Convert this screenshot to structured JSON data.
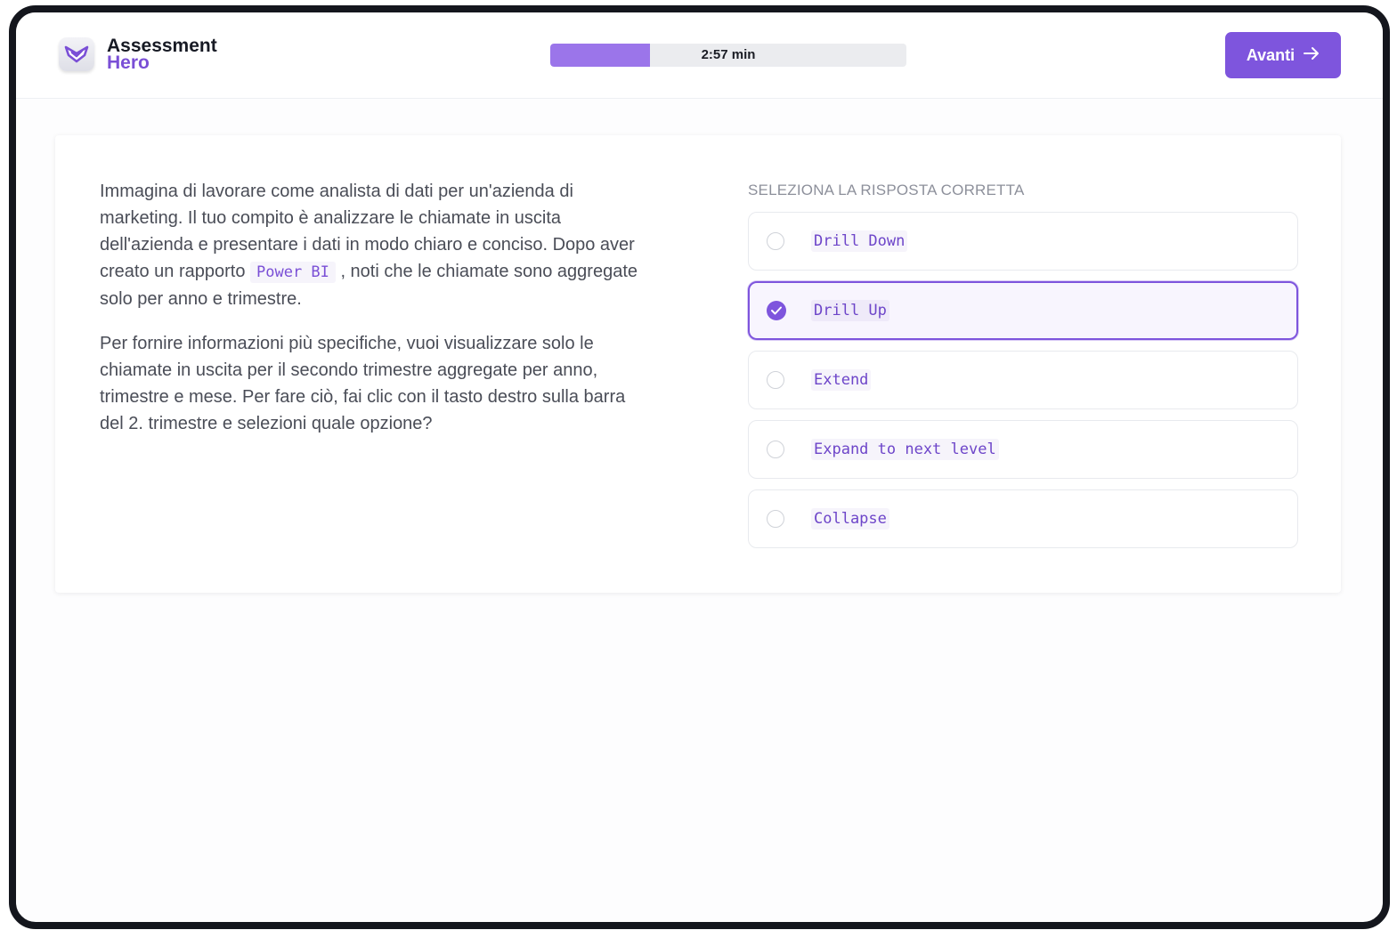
{
  "header": {
    "logo_line1": "Assessment",
    "logo_line2": "Hero",
    "timer_label": "2:57 min",
    "timer_progress_fraction": 0.28,
    "next_label": "Avanti"
  },
  "question": {
    "p1_before": "Immagina di lavorare come analista di dati per un'azienda di marketing. Il tuo compito è analizzare le chiamate in uscita dell'azienda e presentare i dati in modo chiaro e conciso. Dopo aver creato un rapporto ",
    "p1_code": "Power BI",
    "p1_after": " , noti che le chiamate sono aggregate solo per anno e trimestre.",
    "p2": "Per fornire informazioni più specifiche, vuoi visualizzare solo le chiamate in uscita per il secondo trimestre aggregate per anno, trimestre e mese. Per fare ciò, fai clic con il tasto destro sulla barra del 2. trimestre e selezioni quale opzione?"
  },
  "answers": {
    "title": "SELEZIONA LA RISPOSTA CORRETTA",
    "options": [
      {
        "label": "Drill Down",
        "selected": false
      },
      {
        "label": "Drill Up",
        "selected": true
      },
      {
        "label": "Extend",
        "selected": false
      },
      {
        "label": "Expand to next level",
        "selected": false
      },
      {
        "label": "Collapse",
        "selected": false
      }
    ]
  },
  "colors": {
    "accent": "#7e55dd",
    "progress_fill": "#9b75ea",
    "frame": "#14161d"
  }
}
